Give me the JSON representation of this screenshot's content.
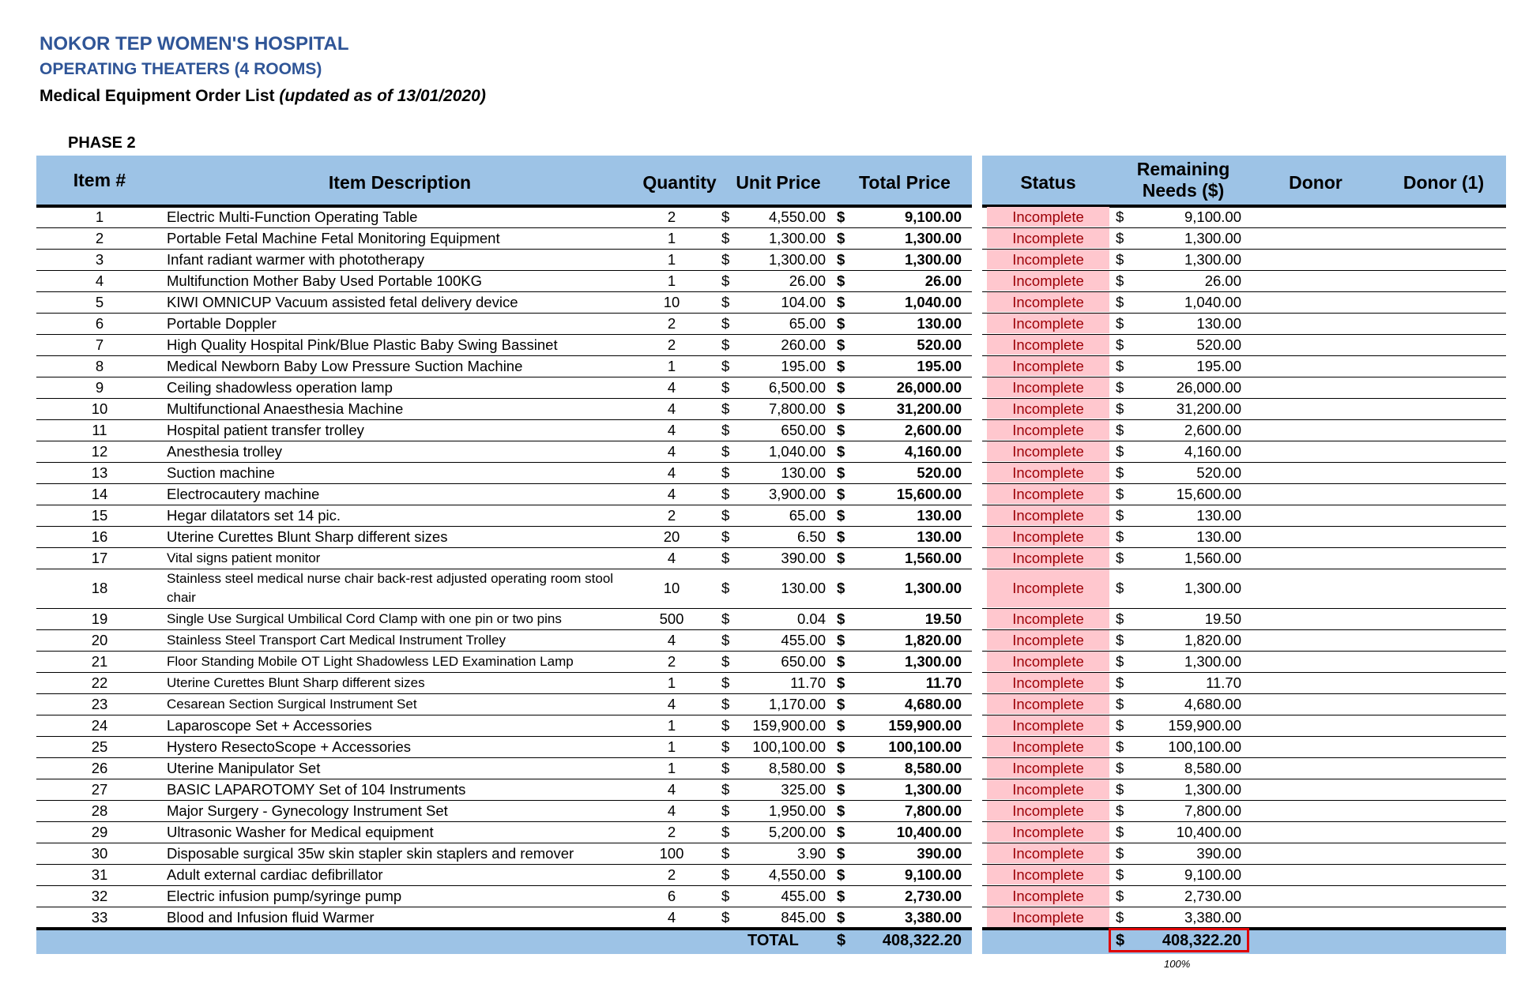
{
  "header": {
    "hospital": "NOKOR TEP WOMEN'S HOSPITAL",
    "department": "OPERATING THEATERS (4 ROOMS)",
    "list_title": "Medical Equipment Order List",
    "updated": "(updated as of 13/01/2020)",
    "phase": "PHASE 2"
  },
  "columns": {
    "item": "Item #",
    "description": "Item Description",
    "quantity": "Quantity",
    "unit_price": "Unit Price",
    "total_price": "Total Price",
    "status": "Status",
    "remaining_line1": "Remaining",
    "remaining_line2": "Needs ($)",
    "donor": "Donor",
    "donor1": "Donor (1)"
  },
  "currency": "$",
  "items": [
    {
      "num": "1",
      "desc": "Electric Multi-Function Operating Table",
      "qty": "2",
      "unit": "4,550.00",
      "total": "9,100.00",
      "status": "Incomplete",
      "remaining": "9,100.00"
    },
    {
      "num": "2",
      "desc": "Portable Fetal Machine Fetal Monitoring Equipment",
      "qty": "1",
      "unit": "1,300.00",
      "total": "1,300.00",
      "status": "Incomplete",
      "remaining": "1,300.00"
    },
    {
      "num": "3",
      "desc": "Infant radiant warmer with phototherapy",
      "qty": "1",
      "unit": "1,300.00",
      "total": "1,300.00",
      "status": "Incomplete",
      "remaining": "1,300.00"
    },
    {
      "num": "4",
      "desc": "Multifunction Mother Baby Used Portable 100KG",
      "qty": "1",
      "unit": "26.00",
      "total": "26.00",
      "status": "Incomplete",
      "remaining": "26.00"
    },
    {
      "num": "5",
      "desc": "KIWI OMNICUP Vacuum assisted fetal delivery device",
      "qty": "10",
      "unit": "104.00",
      "total": "1,040.00",
      "status": "Incomplete",
      "remaining": "1,040.00"
    },
    {
      "num": "6",
      "desc": "Portable Doppler",
      "qty": "2",
      "unit": "65.00",
      "total": "130.00",
      "status": "Incomplete",
      "remaining": "130.00"
    },
    {
      "num": "7",
      "desc": "High Quality Hospital Pink/Blue Plastic Baby Swing Bassinet",
      "qty": "2",
      "unit": "260.00",
      "total": "520.00",
      "status": "Incomplete",
      "remaining": "520.00"
    },
    {
      "num": "8",
      "desc": "Medical Newborn Baby Low Pressure Suction Machine",
      "qty": "1",
      "unit": "195.00",
      "total": "195.00",
      "status": "Incomplete",
      "remaining": "195.00"
    },
    {
      "num": "9",
      "desc": "Ceiling shadowless operation lamp",
      "qty": "4",
      "unit": "6,500.00",
      "total": "26,000.00",
      "status": "Incomplete",
      "remaining": "26,000.00"
    },
    {
      "num": "10",
      "desc": "Multifunctional Anaesthesia Machine",
      "qty": "4",
      "unit": "7,800.00",
      "total": "31,200.00",
      "status": "Incomplete",
      "remaining": "31,200.00"
    },
    {
      "num": "11",
      "desc": "Hospital patient transfer trolley",
      "qty": "4",
      "unit": "650.00",
      "total": "2,600.00",
      "status": "Incomplete",
      "remaining": "2,600.00"
    },
    {
      "num": "12",
      "desc": "Anesthesia trolley",
      "qty": "4",
      "unit": "1,040.00",
      "total": "4,160.00",
      "status": "Incomplete",
      "remaining": "4,160.00"
    },
    {
      "num": "13",
      "desc": "Suction machine",
      "qty": "4",
      "unit": "130.00",
      "total": "520.00",
      "status": "Incomplete",
      "remaining": "520.00"
    },
    {
      "num": "14",
      "desc": "Electrocautery machine",
      "qty": "4",
      "unit": "3,900.00",
      "total": "15,600.00",
      "status": "Incomplete",
      "remaining": "15,600.00"
    },
    {
      "num": "15",
      "desc": "Hegar dilatators set 14 pic.",
      "qty": "2",
      "unit": "65.00",
      "total": "130.00",
      "status": "Incomplete",
      "remaining": "130.00"
    },
    {
      "num": "16",
      "desc": "Uterine Curettes Blunt Sharp different sizes",
      "qty": "20",
      "unit": "6.50",
      "total": "130.00",
      "status": "Incomplete",
      "remaining": "130.00"
    },
    {
      "num": "17",
      "desc": "Vital signs patient monitor",
      "qty": "4",
      "unit": "390.00",
      "total": "1,560.00",
      "status": "Incomplete",
      "remaining": "1,560.00",
      "small": true
    },
    {
      "num": "18",
      "desc": "Stainless steel medical nurse chair back-rest adjusted operating room stool chair",
      "qty": "10",
      "unit": "130.00",
      "total": "1,300.00",
      "status": "Incomplete",
      "remaining": "1,300.00",
      "small": true,
      "tall": true
    },
    {
      "num": "19",
      "desc": "Single Use Surgical Umbilical Cord Clamp with one pin or two pins",
      "qty": "500",
      "unit": "0.04",
      "total": "19.50",
      "status": "Incomplete",
      "remaining": "19.50",
      "small": true
    },
    {
      "num": "20",
      "desc": "Stainless Steel Transport Cart Medical Instrument Trolley",
      "qty": "4",
      "unit": "455.00",
      "total": "1,820.00",
      "status": "Incomplete",
      "remaining": "1,820.00",
      "small": true
    },
    {
      "num": "21",
      "desc": "Floor Standing Mobile OT Light Shadowless LED Examination Lamp",
      "qty": "2",
      "unit": "650.00",
      "total": "1,300.00",
      "status": "Incomplete",
      "remaining": "1,300.00",
      "small": true
    },
    {
      "num": "22",
      "desc": "Uterine Curettes Blunt Sharp different sizes",
      "qty": "1",
      "unit": "11.70",
      "total": "11.70",
      "status": "Incomplete",
      "remaining": "11.70",
      "small": true
    },
    {
      "num": "23",
      "desc": "Cesarean Section Surgical Instrument Set",
      "qty": "4",
      "unit": "1,170.00",
      "total": "4,680.00",
      "status": "Incomplete",
      "remaining": "4,680.00",
      "small": true
    },
    {
      "num": "24",
      "desc": "Laparoscope Set + Accessories",
      "qty": "1",
      "unit": "159,900.00",
      "total": "159,900.00",
      "status": "Incomplete",
      "remaining": "159,900.00"
    },
    {
      "num": "25",
      "desc": "Hystero ResectoScope + Accessories",
      "qty": "1",
      "unit": "100,100.00",
      "total": "100,100.00",
      "status": "Incomplete",
      "remaining": "100,100.00"
    },
    {
      "num": "26",
      "desc": "Uterine Manipulator Set",
      "qty": "1",
      "unit": "8,580.00",
      "total": "8,580.00",
      "status": "Incomplete",
      "remaining": "8,580.00"
    },
    {
      "num": "27",
      "desc": "BASIC LAPAROTOMY Set of 104 Instruments",
      "qty": "4",
      "unit": "325.00",
      "total": "1,300.00",
      "status": "Incomplete",
      "remaining": "1,300.00"
    },
    {
      "num": "28",
      "desc": "Major Surgery - Gynecology Instrument Set",
      "qty": "4",
      "unit": "1,950.00",
      "total": "7,800.00",
      "status": "Incomplete",
      "remaining": "7,800.00"
    },
    {
      "num": "29",
      "desc": "Ultrasonic Washer for Medical equipment",
      "qty": "2",
      "unit": "5,200.00",
      "total": "10,400.00",
      "status": "Incomplete",
      "remaining": "10,400.00"
    },
    {
      "num": "30",
      "desc": "Disposable surgical 35w skin stapler skin staplers and remover",
      "qty": "100",
      "unit": "3.90",
      "total": "390.00",
      "status": "Incomplete",
      "remaining": "390.00"
    },
    {
      "num": "31",
      "desc": "Adult external cardiac defibrillator",
      "qty": "2",
      "unit": "4,550.00",
      "total": "9,100.00",
      "status": "Incomplete",
      "remaining": "9,100.00"
    },
    {
      "num": "32",
      "desc": "Electric infusion pump/syringe pump",
      "qty": "6",
      "unit": "455.00",
      "total": "2,730.00",
      "status": "Incomplete",
      "remaining": "2,730.00"
    },
    {
      "num": "33",
      "desc": "Blood and Infusion fluid Warmer",
      "qty": "4",
      "unit": "845.00",
      "total": "3,380.00",
      "status": "Incomplete",
      "remaining": "3,380.00"
    }
  ],
  "totals": {
    "label": "TOTAL",
    "total_price": "408,322.20",
    "remaining": "408,322.20",
    "remaining_percent": "100%"
  }
}
